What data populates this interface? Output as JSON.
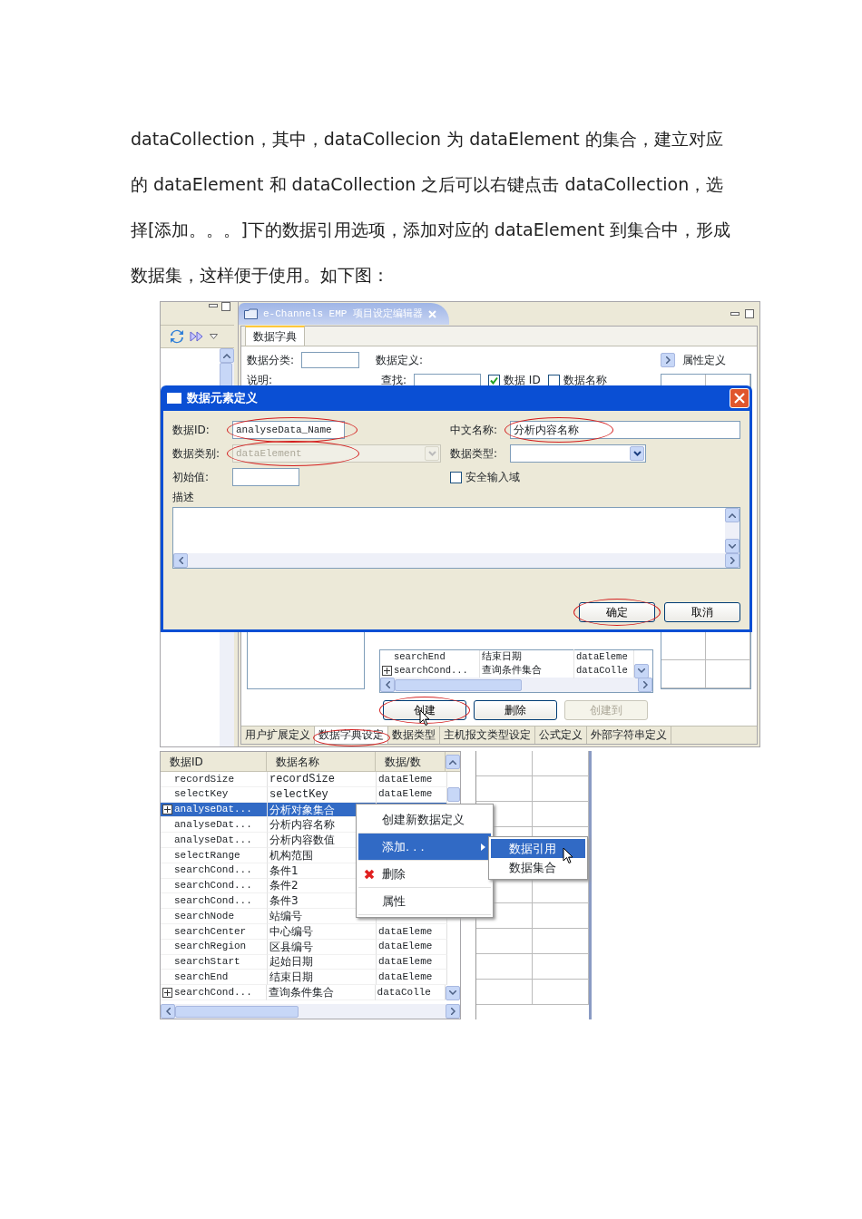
{
  "paragraph": "dataCollection，其中，dataCollecion 为 dataElement 的集合，建立对应的 dataElement 和 dataCollection 之后可以右键点击 dataCollection，选择[添加。。。]下的数据引用选项，添加对应的 dataElement 到集合中，形成数据集，这样便于使用。如下图：",
  "figure_1": {
    "editor": {
      "title": "e-Channels EMP 项目设定编辑器",
      "tabs": [
        {
          "label": "数据字典",
          "selected": true
        }
      ],
      "category_label": "数据分类:",
      "definition_label": "数据定义:",
      "property_label": "属性定义",
      "description_label": "说明:",
      "search_label": "查找:",
      "filters": [
        {
          "label": "数据 ID",
          "checked": true
        },
        {
          "label": "数据名称",
          "checked": false
        }
      ],
      "table_rows": [
        {
          "id": "searchEnd",
          "name": "结束日期",
          "type": "dataEleme",
          "expandable": false
        },
        {
          "id": "searchCond...",
          "name": "查询条件集合",
          "type": "dataColle",
          "expandable": true
        }
      ],
      "buttons": [
        {
          "label": "创建",
          "disabled": false,
          "circled": true
        },
        {
          "label": "删除",
          "disabled": false,
          "circled": false
        },
        {
          "label": "创建到",
          "disabled": true,
          "circled": false
        }
      ],
      "bottom_tabs": [
        {
          "label": "用户扩展定义",
          "selected": false,
          "circled": false
        },
        {
          "label": "数据字典设定",
          "selected": true,
          "circled": true
        },
        {
          "label": "数据类型",
          "selected": false,
          "circled": false
        },
        {
          "label": "主机报文类型设定",
          "selected": false,
          "circled": false
        },
        {
          "label": "公式定义",
          "selected": false,
          "circled": false
        },
        {
          "label": "外部字符串定义",
          "selected": false,
          "circled": false
        }
      ]
    },
    "dialog": {
      "title": "数据元素定义",
      "left_fields": [
        {
          "kind": "text",
          "label": "数据ID:",
          "value": "analyseData_Name",
          "disabled": false,
          "circled": true
        },
        {
          "kind": "select",
          "label": "数据类别:",
          "value": "dataElement",
          "disabled": true,
          "circled": true
        },
        {
          "kind": "text",
          "label": "初始值:",
          "disabled": false,
          "circled": false
        }
      ],
      "right_fields": [
        {
          "kind": "text",
          "label": "中文名称:",
          "value": "分析内容名称",
          "disabled": false,
          "circled": true
        },
        {
          "kind": "select",
          "label": "数据类型:",
          "disabled": false,
          "circled": false
        },
        {
          "kind": "checkbox",
          "label": "安全输入域",
          "checked": false
        }
      ],
      "description_label": "描述",
      "buttons": [
        {
          "label": "确定",
          "circled": true
        },
        {
          "label": "取消",
          "circled": false
        }
      ]
    }
  },
  "figure_2": {
    "columns": [
      "数据ID",
      "数据名称",
      "数据/数"
    ],
    "rows": [
      {
        "id": "recordSize",
        "name": "recordSize",
        "type": "dataEleme",
        "expandable": false,
        "selected": false
      },
      {
        "id": "selectKey",
        "name": "selectKey",
        "type": "dataEleme",
        "expandable": false,
        "selected": false
      },
      {
        "id": "analyseDat...",
        "name": "分析对象集合",
        "expandable": true,
        "selected": true
      },
      {
        "id": "analyseDat...",
        "name": "分析内容名称",
        "expandable": false,
        "selected": false
      },
      {
        "id": "analyseDat...",
        "name": "分析内容数值",
        "expandable": false,
        "selected": false
      },
      {
        "id": "selectRange",
        "name": "机构范围",
        "expandable": false,
        "selected": false
      },
      {
        "id": "searchCond...",
        "name": "条件1",
        "expandable": false,
        "selected": false
      },
      {
        "id": "searchCond...",
        "name": "条件2",
        "expandable": false,
        "selected": false
      },
      {
        "id": "searchCond...",
        "name": "条件3",
        "expandable": false,
        "selected": false
      },
      {
        "id": "searchNode",
        "name": "站编号",
        "expandable": false,
        "selected": false
      },
      {
        "id": "searchCenter",
        "name": "中心编号",
        "type": "dataEleme",
        "expandable": false,
        "selected": false
      },
      {
        "id": "searchRegion",
        "name": "区县编号",
        "type": "dataEleme",
        "expandable": false,
        "selected": false
      },
      {
        "id": "searchStart",
        "name": "起始日期",
        "type": "dataEleme",
        "expandable": false,
        "selected": false
      },
      {
        "id": "searchEnd",
        "name": "结束日期",
        "type": "dataEleme",
        "expandable": false,
        "selected": false
      },
      {
        "id": "searchCond...",
        "name": "查询条件集合",
        "type": "dataColle",
        "expandable": true,
        "selected": false
      }
    ],
    "context_menu": [
      {
        "kind": "item",
        "label": "创建新数据定义",
        "selected": false
      },
      {
        "kind": "submenu",
        "label": "添加. . .",
        "selected": true
      },
      {
        "kind": "delete",
        "label": "删除",
        "selected": false
      },
      {
        "kind": "item",
        "label": "属性",
        "selected": false
      }
    ],
    "submenu": [
      {
        "label": "数据引用",
        "selected": true
      },
      {
        "label": "数据集合",
        "selected": false
      }
    ]
  }
}
